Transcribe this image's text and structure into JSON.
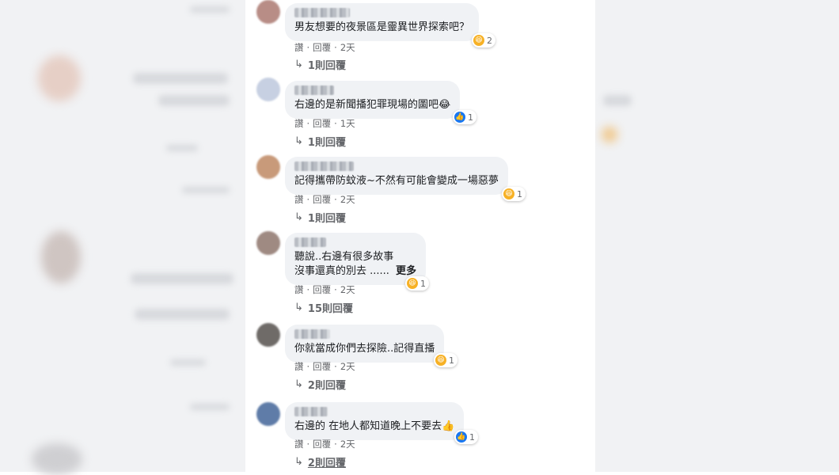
{
  "comments": [
    {
      "text_lines": [
        "男友想要的夜景區是靈異世界探索吧？"
      ],
      "react_icon": "haha-icon",
      "react_count": "2",
      "actions": {
        "like": "讚",
        "reply": "回覆",
        "sep": "·",
        "time": "2天"
      },
      "replies": "1則回覆",
      "avatar_color": "#b88d86"
    },
    {
      "text_lines": [
        "右邊的是新聞播犯罪現場的圖吧😂"
      ],
      "react_icon": "like-icon",
      "react_count": "1",
      "actions": {
        "like": "讚",
        "reply": "回覆",
        "sep": "·",
        "time": "1天"
      },
      "replies": "1則回覆",
      "avatar_color": "#c7d0e2"
    },
    {
      "text_lines": [
        "記得攜帶防蚊液~不然有可能會變成一場惡夢"
      ],
      "react_icon": "haha-icon",
      "react_count": "1",
      "actions": {
        "like": "讚",
        "reply": "回覆",
        "sep": "·",
        "time": "2天"
      },
      "replies": "1則回覆",
      "avatar_color": "#c89a7a"
    },
    {
      "text_lines": [
        "聽說..右邊有很多故事",
        "沒事還真的別去 ......"
      ],
      "more": "更多",
      "react_icon": "haha-icon",
      "react_count": "1",
      "actions": {
        "like": "讚",
        "reply": "回覆",
        "sep": "·",
        "time": "2天"
      },
      "replies": "15則回覆",
      "avatar_color": "#9f8a82"
    },
    {
      "text_lines": [
        "你就當成你們去探險..記得直播"
      ],
      "react_icon": "haha-icon",
      "react_count": "1",
      "actions": {
        "like": "讚",
        "reply": "回覆",
        "sep": "·",
        "time": "2天"
      },
      "replies": "2則回覆",
      "avatar_color": "#6f6b68"
    },
    {
      "text_lines": [
        "右邊的 在地人都知道晚上不要去👍"
      ],
      "react_icon": "like-icon",
      "react_count": "1",
      "actions": {
        "like": "讚",
        "reply": "回覆",
        "sep": "·",
        "time": "2天"
      },
      "replies": "2則回覆",
      "avatar_color": "#5f7ca8"
    }
  ],
  "colors": {
    "bubble": "#f0f2f5",
    "text": "#1c1e21",
    "meta": "#65676b",
    "like": "#1877f2",
    "haha": "#f7b125"
  }
}
